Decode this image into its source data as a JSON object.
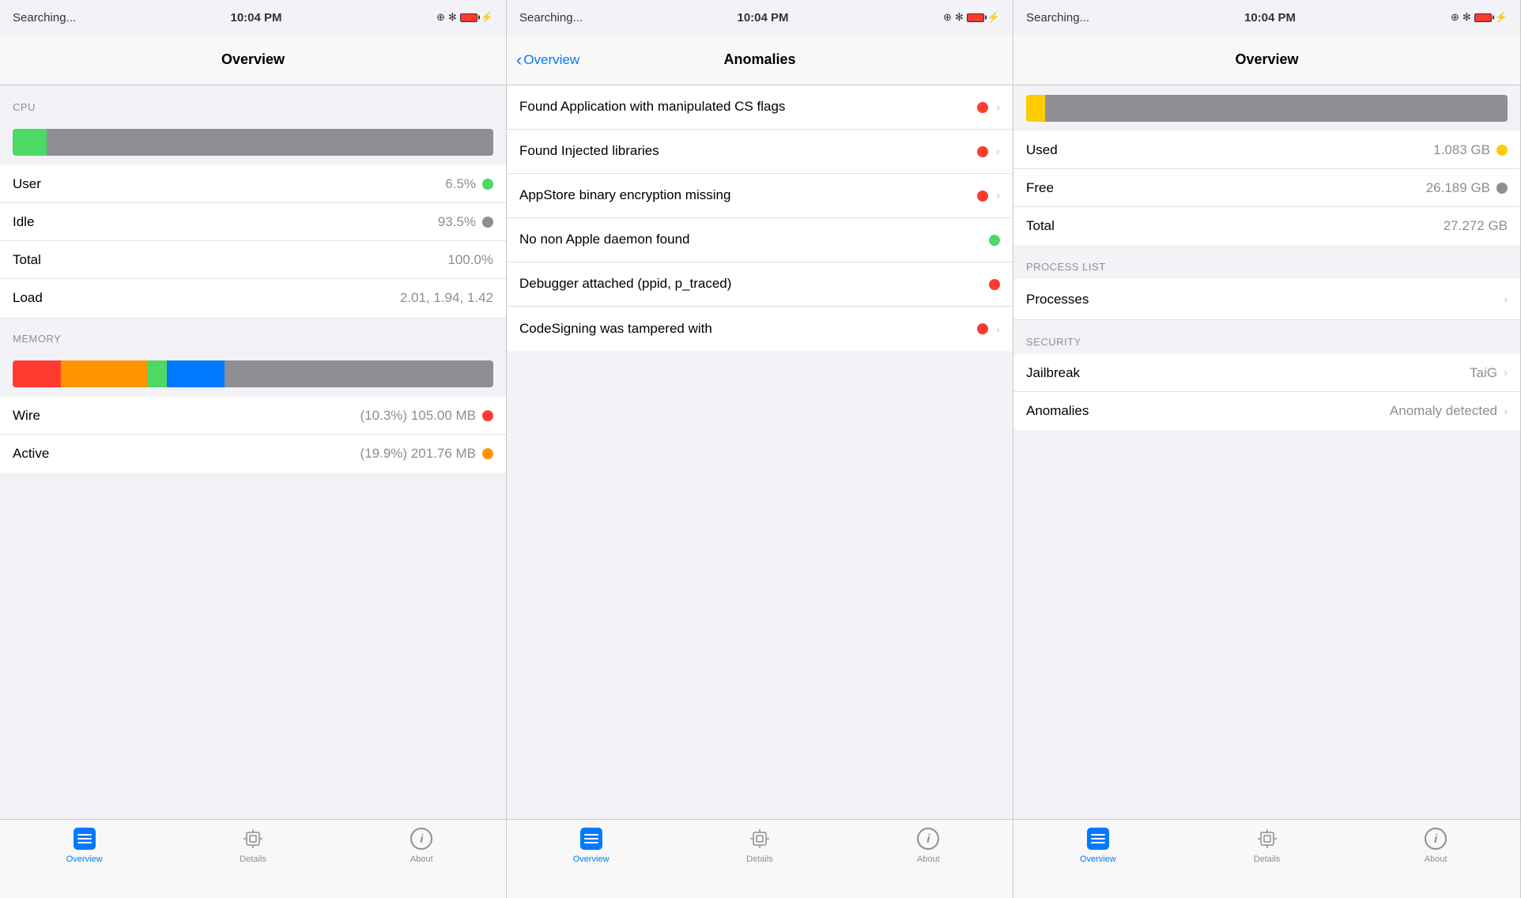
{
  "panels": [
    {
      "id": "panel1",
      "statusBar": {
        "left": "Searching...",
        "center": "10:04 PM",
        "icons": [
          "location",
          "bluetooth",
          "battery",
          "charging"
        ]
      },
      "navTitle": "Overview",
      "hasBack": false,
      "sections": [
        {
          "id": "cpu",
          "header": "CPU",
          "cells": [
            {
              "label": "User",
              "value": "6.5%",
              "dot": "green"
            },
            {
              "label": "Idle",
              "value": "93.5%",
              "dot": "gray"
            },
            {
              "label": "Total",
              "value": "100.0%",
              "dot": null
            },
            {
              "label": "Load",
              "value": "2.01, 1.94, 1.42",
              "dot": null
            }
          ]
        },
        {
          "id": "memory",
          "header": "MEMORY",
          "cells": [
            {
              "label": "Wire",
              "value": "(10.3%) 105.00 MB",
              "dot": "red"
            },
            {
              "label": "Active",
              "value": "(19.9%) 201.76 MB",
              "dot": "orange"
            }
          ]
        }
      ],
      "tabs": [
        {
          "label": "Overview",
          "active": true,
          "icon": "overview"
        },
        {
          "label": "Details",
          "active": false,
          "icon": "details"
        },
        {
          "label": "About",
          "active": false,
          "icon": "about"
        }
      ]
    },
    {
      "id": "panel2",
      "statusBar": {
        "left": "Searching...",
        "center": "10:04 PM"
      },
      "navTitle": "Anomalies",
      "hasBack": true,
      "backLabel": "Overview",
      "anomalies": [
        {
          "label": "Found Application with manipulated CS flags",
          "dot": "red",
          "hasChevron": true
        },
        {
          "label": "Found Injected libraries",
          "dot": "red",
          "hasChevron": true
        },
        {
          "label": "AppStore binary encryption missing",
          "dot": "red",
          "hasChevron": true
        },
        {
          "label": "No non Apple daemon found",
          "dot": "green",
          "hasChevron": false
        },
        {
          "label": "Debugger attached (ppid, p_traced)",
          "dot": "red",
          "hasChevron": false
        },
        {
          "label": "CodeSigning was tampered with",
          "dot": "red",
          "hasChevron": true
        }
      ],
      "tabs": [
        {
          "label": "Overview",
          "active": true,
          "icon": "overview"
        },
        {
          "label": "Details",
          "active": false,
          "icon": "details"
        },
        {
          "label": "About",
          "active": false,
          "icon": "about"
        }
      ]
    },
    {
      "id": "panel3",
      "statusBar": {
        "left": "Searching...",
        "center": "10:04 PM"
      },
      "navTitle": "Overview",
      "hasBack": false,
      "storage": {
        "used": "1.083 GB",
        "free": "26.189 GB",
        "total": "27.272 GB"
      },
      "processList": {
        "header": "PROCESS LIST",
        "label": "Processes",
        "hasChevron": true
      },
      "security": {
        "header": "SECURITY",
        "items": [
          {
            "label": "Jailbreak",
            "value": "TaiG",
            "hasChevron": true
          },
          {
            "label": "Anomalies",
            "value": "Anomaly detected",
            "hasChevron": true
          }
        ]
      },
      "tabs": [
        {
          "label": "Overview",
          "active": true,
          "icon": "overview"
        },
        {
          "label": "Details",
          "active": false,
          "icon": "details"
        },
        {
          "label": "About",
          "active": false,
          "icon": "about"
        }
      ]
    }
  ]
}
